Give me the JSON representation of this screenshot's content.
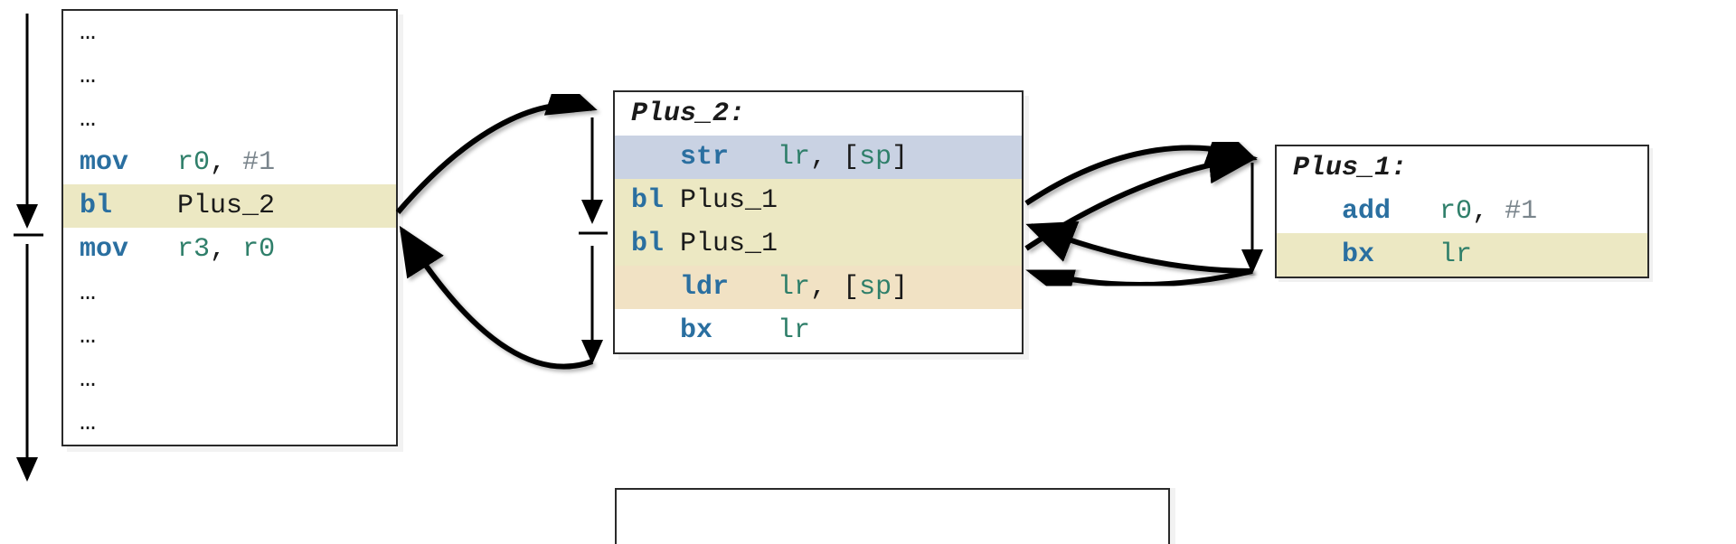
{
  "colors": {
    "mnemonic": "#2a6fa0",
    "register": "#2f7f6a",
    "number": "#7a858c",
    "hl_yellow": "#ece8c3",
    "hl_blue": "#c9d2e3",
    "hl_orange": "#f1e2c4"
  },
  "blocks": {
    "left": {
      "lines": [
        {
          "text": "…",
          "hl": null
        },
        {
          "text": "…",
          "hl": null
        },
        {
          "text": "…",
          "hl": null
        },
        {
          "spans": [
            {
              "t": "mov",
              "c": "mn"
            },
            {
              "t": "   ",
              "c": "tx"
            },
            {
              "t": "r0",
              "c": "rg"
            },
            {
              "t": ", ",
              "c": "tx"
            },
            {
              "t": "#1",
              "c": "nm"
            }
          ]
        },
        {
          "hl": "Y",
          "spans": [
            {
              "t": "bl",
              "c": "mn"
            },
            {
              "t": "    ",
              "c": "tx"
            },
            {
              "t": "Plus_2",
              "c": "tx"
            }
          ]
        },
        {
          "spans": [
            {
              "t": "mov",
              "c": "mn"
            },
            {
              "t": "   ",
              "c": "tx"
            },
            {
              "t": "r3",
              "c": "rg"
            },
            {
              "t": ", ",
              "c": "tx"
            },
            {
              "t": "r0",
              "c": "rg"
            }
          ]
        },
        {
          "text": "…",
          "hl": null
        },
        {
          "text": "…",
          "hl": null
        },
        {
          "text": "…",
          "hl": null
        },
        {
          "text": "…",
          "hl": null
        }
      ]
    },
    "mid": {
      "label": "Plus_2:",
      "lines": [
        {
          "hl": "B",
          "indent": "   ",
          "spans": [
            {
              "t": "str",
              "c": "mn"
            },
            {
              "t": "   ",
              "c": "tx"
            },
            {
              "t": "lr",
              "c": "rg"
            },
            {
              "t": ", [",
              "c": "tx"
            },
            {
              "t": "sp",
              "c": "rg"
            },
            {
              "t": "]",
              "c": "tx"
            }
          ]
        },
        {
          "hl": "Y",
          "spans": [
            {
              "t": "bl",
              "c": "mn"
            },
            {
              "t": " ",
              "c": "tx"
            },
            {
              "t": "Plus_1",
              "c": "tx"
            }
          ]
        },
        {
          "hl": "Y",
          "spans": [
            {
              "t": "bl",
              "c": "mn"
            },
            {
              "t": " ",
              "c": "tx"
            },
            {
              "t": "Plus_1",
              "c": "tx"
            }
          ]
        },
        {
          "hl": "O",
          "indent": "   ",
          "spans": [
            {
              "t": "ldr",
              "c": "mn"
            },
            {
              "t": "   ",
              "c": "tx"
            },
            {
              "t": "lr",
              "c": "rg"
            },
            {
              "t": ", [",
              "c": "tx"
            },
            {
              "t": "sp",
              "c": "rg"
            },
            {
              "t": "]",
              "c": "tx"
            }
          ]
        },
        {
          "indent": "   ",
          "spans": [
            {
              "t": "bx",
              "c": "mn"
            },
            {
              "t": "    ",
              "c": "tx"
            },
            {
              "t": "lr",
              "c": "rg"
            }
          ]
        }
      ]
    },
    "right": {
      "label": "Plus_1:",
      "lines": [
        {
          "indent": "   ",
          "spans": [
            {
              "t": "add",
              "c": "mn"
            },
            {
              "t": "   ",
              "c": "tx"
            },
            {
              "t": "r0",
              "c": "rg"
            },
            {
              "t": ", ",
              "c": "tx"
            },
            {
              "t": "#1",
              "c": "nm"
            }
          ]
        },
        {
          "hl": "Y",
          "indent": "   ",
          "spans": [
            {
              "t": "bx",
              "c": "mn"
            },
            {
              "t": "    ",
              "c": "tx"
            },
            {
              "t": "lr",
              "c": "rg"
            }
          ]
        }
      ]
    }
  }
}
